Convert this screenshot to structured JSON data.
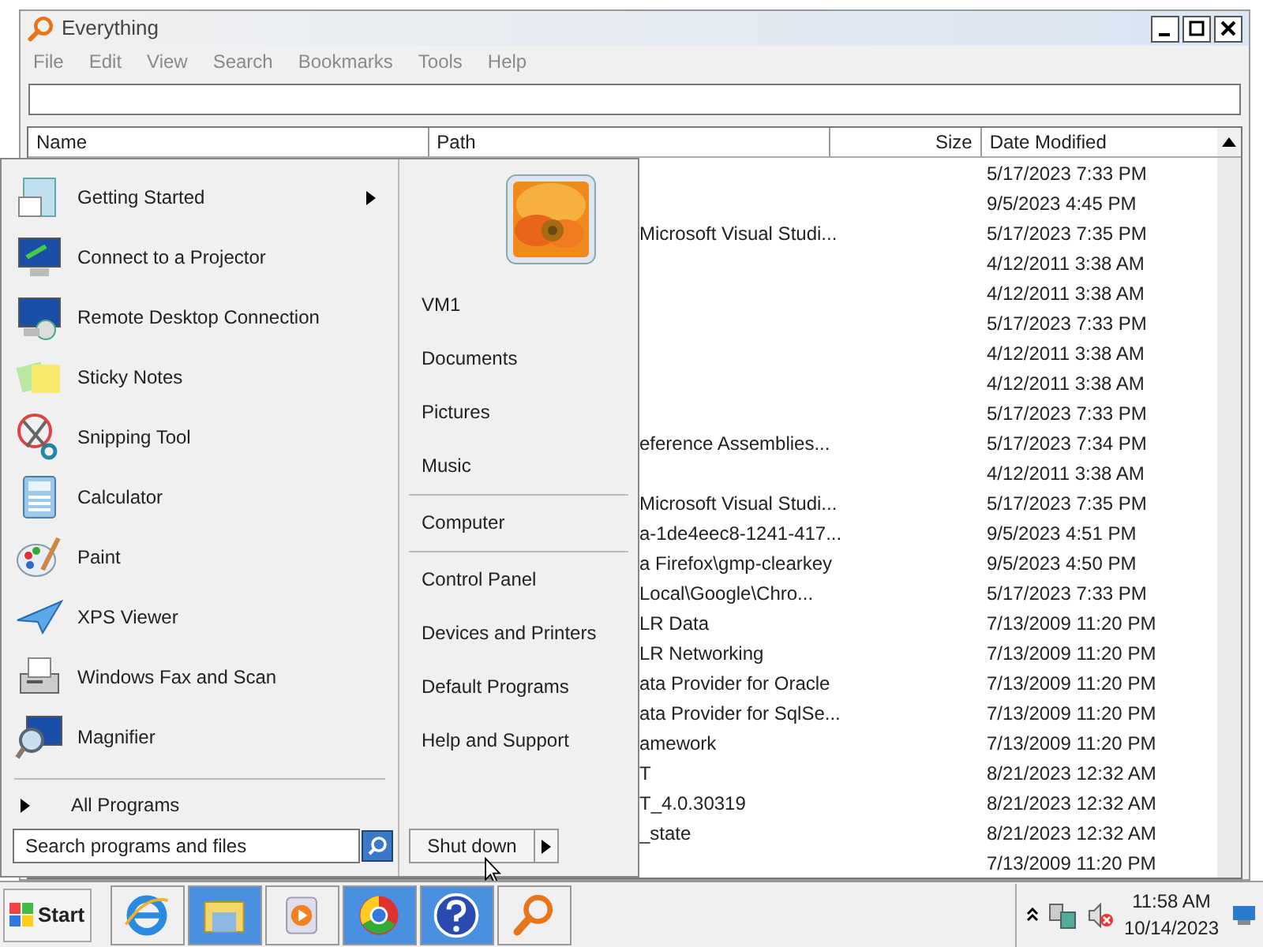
{
  "window": {
    "title": "Everything"
  },
  "menu": [
    "File",
    "Edit",
    "View",
    "Search",
    "Bookmarks",
    "Tools",
    "Help"
  ],
  "table": {
    "columns": [
      "Name",
      "Path",
      "Size",
      "Date Modified"
    ],
    "rows": [
      {
        "path": "",
        "date": "5/17/2023 7:33 PM"
      },
      {
        "path": "",
        "date": "9/5/2023 4:45 PM"
      },
      {
        "path": "Microsoft Visual Studi...",
        "date": "5/17/2023 7:35 PM"
      },
      {
        "path": "",
        "date": "4/12/2011 3:38 AM"
      },
      {
        "path": "",
        "date": "4/12/2011 3:38 AM"
      },
      {
        "path": "",
        "date": "5/17/2023 7:33 PM"
      },
      {
        "path": "",
        "date": "4/12/2011 3:38 AM"
      },
      {
        "path": "",
        "date": "4/12/2011 3:38 AM"
      },
      {
        "path": "",
        "date": "5/17/2023 7:33 PM"
      },
      {
        "path": "eference Assemblies...",
        "date": "5/17/2023 7:34 PM"
      },
      {
        "path": "",
        "date": "4/12/2011 3:38 AM"
      },
      {
        "path": "Microsoft Visual Studi...",
        "date": "5/17/2023 7:35 PM"
      },
      {
        "path": "a-1de4eec8-1241-417...",
        "date": "9/5/2023 4:51 PM"
      },
      {
        "path": "a Firefox\\gmp-clearkey",
        "date": "9/5/2023 4:50 PM"
      },
      {
        "path": "Local\\Google\\Chro...",
        "date": "5/17/2023 7:33 PM"
      },
      {
        "path": "LR Data",
        "date": "7/13/2009 11:20 PM"
      },
      {
        "path": "LR Networking",
        "date": "7/13/2009 11:20 PM"
      },
      {
        "path": "ata Provider for Oracle",
        "date": "7/13/2009 11:20 PM"
      },
      {
        "path": "ata Provider for SqlSe...",
        "date": "7/13/2009 11:20 PM"
      },
      {
        "path": "amework",
        "date": "7/13/2009 11:20 PM"
      },
      {
        "path": "T",
        "date": "8/21/2023 12:32 AM"
      },
      {
        "path": "T_4.0.30319",
        "date": "8/21/2023 12:32 AM"
      },
      {
        "path": "_state",
        "date": "8/21/2023 12:32 AM"
      },
      {
        "path": "",
        "date": "7/13/2009 11:20 PM"
      }
    ]
  },
  "start_menu": {
    "programs": [
      {
        "label": "Getting Started",
        "submenu": true
      },
      {
        "label": "Connect to a Projector",
        "submenu": false
      },
      {
        "label": "Remote Desktop Connection",
        "submenu": false
      },
      {
        "label": "Sticky Notes",
        "submenu": false
      },
      {
        "label": "Snipping Tool",
        "submenu": false
      },
      {
        "label": "Calculator",
        "submenu": false
      },
      {
        "label": "Paint",
        "submenu": false
      },
      {
        "label": "XPS Viewer",
        "submenu": false
      },
      {
        "label": "Windows Fax and Scan",
        "submenu": false
      },
      {
        "label": "Magnifier",
        "submenu": false
      }
    ],
    "all_programs": "All Programs",
    "search": {
      "placeholder": "Search programs and files"
    },
    "place_groups": [
      [
        "VM1",
        "Documents",
        "Pictures",
        "Music"
      ],
      [
        "Computer"
      ],
      [
        "Control Panel",
        "Devices and Printers",
        "Default Programs",
        "Help and Support"
      ]
    ],
    "shutdown": "Shut down"
  },
  "taskbar": {
    "start": "Start",
    "time": "11:58 AM",
    "date": "10/14/2023"
  }
}
